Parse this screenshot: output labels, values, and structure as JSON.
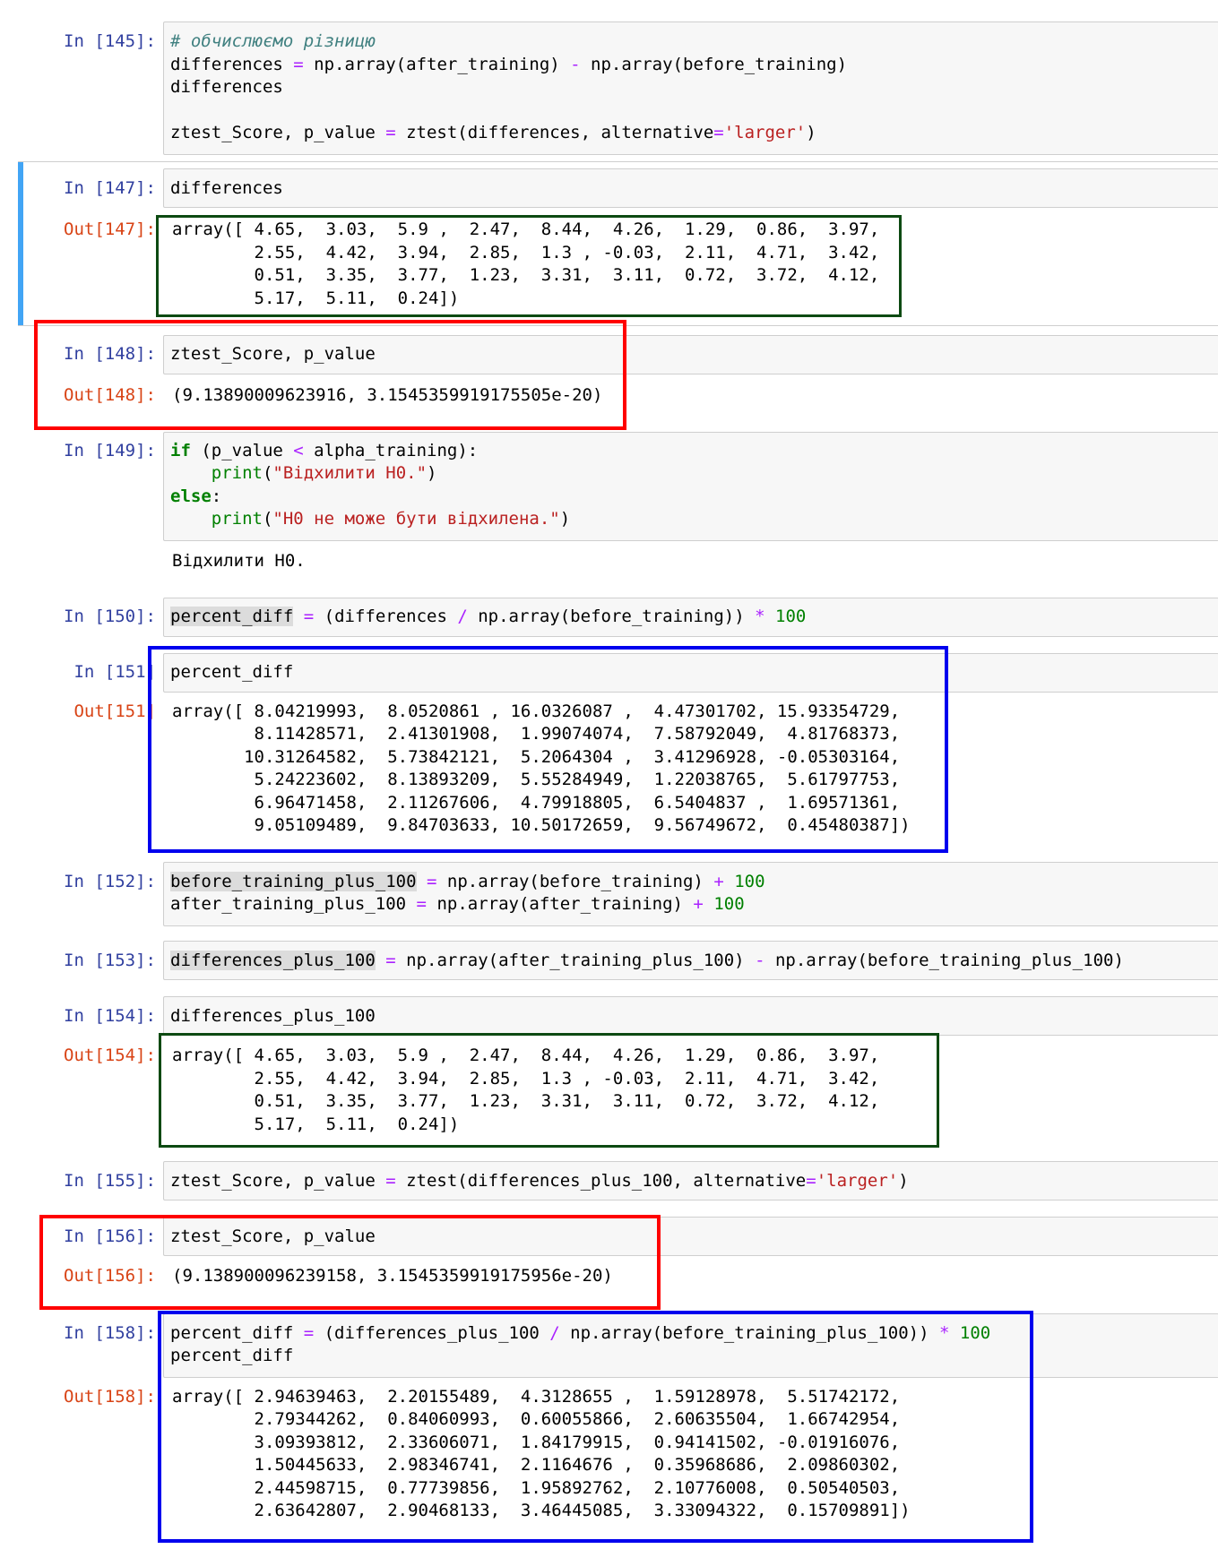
{
  "cells": [
    {
      "in_prompt": "In [145]:",
      "code_lines": [
        "# обчислюємо різницю",
        "differences = np.array(after_training) - np.array(before_training)",
        "differences",
        "",
        "ztest_Score, p_value = ztest(differences, alternative='larger')"
      ]
    },
    {
      "in_prompt": "In [147]:",
      "code_lines": [
        "differences"
      ],
      "out_prompt": "Out[147]:",
      "output_lines": [
        "array([ 4.65,  3.03,  5.9 ,  2.47,  8.44,  4.26,  1.29,  0.86,  3.97,",
        "        2.55,  4.42,  3.94,  2.85,  1.3 , -0.03,  2.11,  4.71,  3.42,",
        "        0.51,  3.35,  3.77,  1.23,  3.31,  3.11,  0.72,  3.72,  4.12,",
        "        5.17,  5.11,  0.24])"
      ],
      "selected": true
    },
    {
      "in_prompt": "In [148]:",
      "code_lines": [
        "ztest_Score, p_value"
      ],
      "out_prompt": "Out[148]:",
      "output_lines": [
        "(9.13890009623916, 3.1545359919175505e-20)"
      ]
    },
    {
      "in_prompt": "In [149]:",
      "code_lines": [
        "if (p_value < alpha_training):",
        "    print(\"Відхилити H0.\")",
        "else:",
        "    print(\"H0 не може бути відхилена.\")"
      ],
      "stream_output": "Відхилити H0."
    },
    {
      "in_prompt": "In [150]:",
      "code_lines": [
        "percent_diff = (differences / np.array(before_training)) * 100"
      ]
    },
    {
      "in_prompt": "In [151]",
      "code_lines": [
        "percent_diff"
      ],
      "out_prompt": "Out[151]",
      "output_lines": [
        "array([ 8.04219993,  8.0520861 , 16.0326087 ,  4.47301702, 15.93354729,",
        "        8.11428571,  2.41301908,  1.99074074,  7.58792049,  4.81768373,",
        "       10.31264582,  5.73842121,  5.2064304 ,  3.41296928, -0.05303164,",
        "        5.24223602,  8.13893209,  5.55284949,  1.22038765,  5.61797753,",
        "        6.96471458,  2.11267606,  4.79918805,  6.5404837 ,  1.69571361,",
        "        9.05109489,  9.84703633, 10.50172659,  9.56749672,  0.45480387])"
      ]
    },
    {
      "in_prompt": "In [152]:",
      "code_lines": [
        "before_training_plus_100 = np.array(before_training) + 100",
        "after_training_plus_100 = np.array(after_training) + 100"
      ]
    },
    {
      "in_prompt": "In [153]:",
      "code_lines": [
        "differences_plus_100 = np.array(after_training_plus_100) - np.array(before_training_plus_100)"
      ]
    },
    {
      "in_prompt": "In [154]:",
      "code_lines": [
        "differences_plus_100"
      ],
      "out_prompt": "Out[154]:",
      "output_lines": [
        "array([ 4.65,  3.03,  5.9 ,  2.47,  8.44,  4.26,  1.29,  0.86,  3.97,",
        "        2.55,  4.42,  3.94,  2.85,  1.3 , -0.03,  2.11,  4.71,  3.42,",
        "        0.51,  3.35,  3.77,  1.23,  3.31,  3.11,  0.72,  3.72,  4.12,",
        "        5.17,  5.11,  0.24])"
      ]
    },
    {
      "in_prompt": "In [155]:",
      "code_lines": [
        "ztest_Score, p_value = ztest(differences_plus_100, alternative='larger')"
      ]
    },
    {
      "in_prompt": "In [156]:",
      "code_lines": [
        "ztest_Score, p_value"
      ],
      "out_prompt": "Out[156]:",
      "output_lines": [
        "(9.138900096239158, 3.1545359919175956e-20)"
      ]
    },
    {
      "in_prompt": "In [158]:",
      "code_lines": [
        "percent_diff = (differences_plus_100 / np.array(before_training_plus_100)) * 100",
        "percent_diff"
      ],
      "out_prompt": "Out[158]:",
      "output_lines": [
        "array([ 2.94639463,  2.20155489,  4.3128655 ,  1.59128978,  5.51742172,",
        "        2.79344262,  0.84060993,  0.60055866,  2.60635504,  1.66742954,",
        "        3.09393812,  2.33606071,  1.84179915,  0.94141502, -0.01916076,",
        "        1.50445633,  2.98346741,  2.1164676 ,  0.35968686,  2.09860302,",
        "        2.44598715,  0.77739856,  1.95892762,  2.10776008,  0.50540503,",
        "        2.63642807,  2.90468133,  3.46445085,  3.33094322,  0.15709891])"
      ]
    }
  ],
  "annotation_colors": {
    "green": "#0d4a12",
    "red": "#ff0000",
    "blue": "#0000ee",
    "selection": "#42a5f5"
  }
}
